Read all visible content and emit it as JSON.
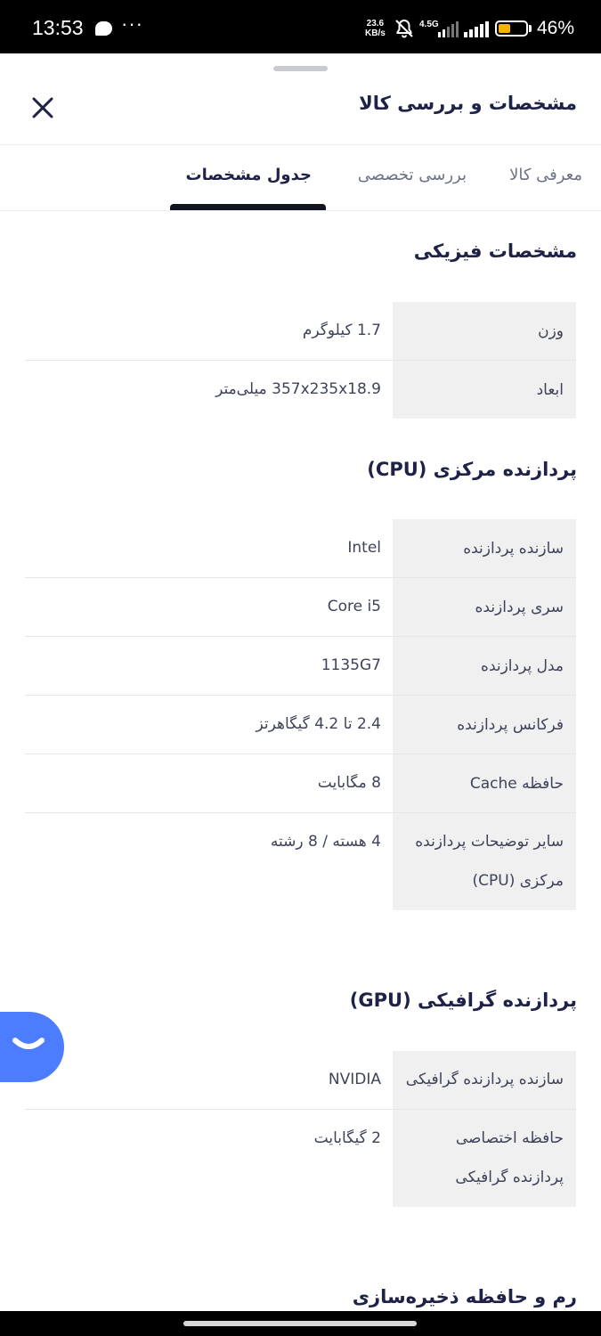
{
  "status_bar": {
    "time": "13:53",
    "overflow": "···",
    "speed_value": "23.6",
    "speed_unit": "KB/s",
    "network_type": "4.5G",
    "battery_percent": "46%",
    "battery_level": 0.46,
    "icons": [
      "chat-bubble-icon",
      "bell-off-icon",
      "signal-icon",
      "battery-icon"
    ]
  },
  "sheet": {
    "title": "مشخصات و بررسی کالا",
    "close_icon": "close-icon"
  },
  "tabs": [
    {
      "label": "معرفی کالا",
      "active": false
    },
    {
      "label": "بررسی تخصصی",
      "active": false
    },
    {
      "label": "جدول مشخصات",
      "active": true
    }
  ],
  "sections": [
    {
      "title": "مشخصات فیزیکی",
      "rows": [
        {
          "label": "وزن",
          "value": "1.7 کیلوگرم"
        },
        {
          "label": "ابعاد",
          "value": "357x235x18.9 میلی‌متر"
        }
      ]
    },
    {
      "title": "پردازنده مرکزی (CPU)",
      "rows": [
        {
          "label": "سازنده پردازنده",
          "value": "Intel"
        },
        {
          "label": "سری پردازنده",
          "value": "Core i5"
        },
        {
          "label": "مدل پردازنده",
          "value": "1135G7"
        },
        {
          "label": "فرکانس پردازنده",
          "value": "2.4 تا 4.2 گیگاهرتز"
        },
        {
          "label": "حافظه Cache",
          "value": "8 مگابایت"
        },
        {
          "label": "سایر توضیحات پردازنده مرکزی (CPU)",
          "value": "4 هسته / 8 رشته"
        }
      ]
    },
    {
      "title": "پردازنده گرافیکی (GPU)",
      "rows": [
        {
          "label": "سازنده پردازنده گرافیکی",
          "value": "NVIDIA"
        },
        {
          "label": "حافظه اختصاصی پردازنده گرافیکی",
          "value": "2 گیگابایت"
        }
      ]
    },
    {
      "title": "رم و حافظه ذخیره‌سازی"
    }
  ],
  "chat_fab_icon": "chat-smile-icon",
  "colors": {
    "accent_fab": "#4c7dff",
    "tab_indicator": "#111320",
    "label_bg": "#f0f0f1",
    "battery_fill": "#f5b400"
  }
}
